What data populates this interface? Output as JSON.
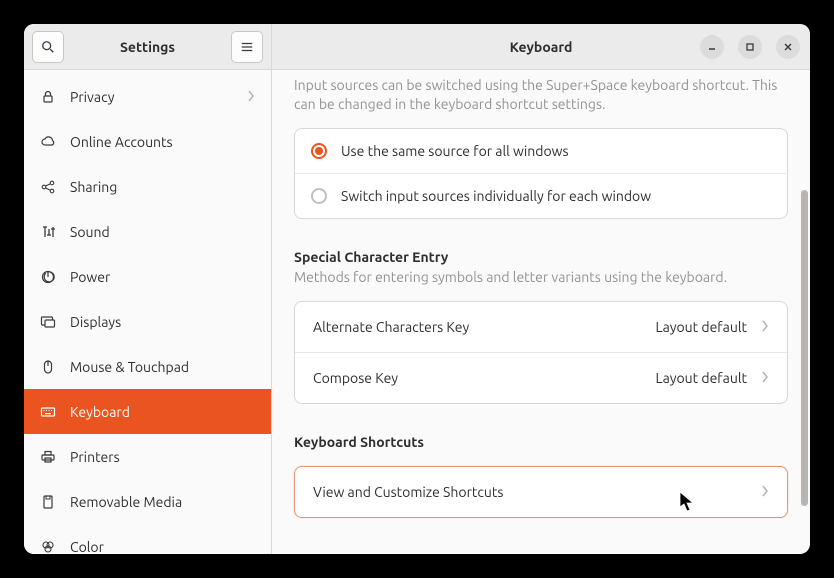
{
  "sidebar": {
    "title": "Settings",
    "items": [
      {
        "label": "Privacy",
        "icon": "lock",
        "chevron": true
      },
      {
        "label": "Online Accounts",
        "icon": "cloud"
      },
      {
        "label": "Sharing",
        "icon": "share"
      },
      {
        "label": "Sound",
        "icon": "sound"
      },
      {
        "label": "Power",
        "icon": "power"
      },
      {
        "label": "Displays",
        "icon": "displays"
      },
      {
        "label": "Mouse & Touchpad",
        "icon": "mouse"
      },
      {
        "label": "Keyboard",
        "icon": "keyboard",
        "active": true
      },
      {
        "label": "Printers",
        "icon": "printer"
      },
      {
        "label": "Removable Media",
        "icon": "media"
      },
      {
        "label": "Color",
        "icon": "color"
      }
    ]
  },
  "header": {
    "title": "Keyboard"
  },
  "main": {
    "intro": "Input sources can be switched using the Super+Space keyboard shortcut. This can be changed in the keyboard shortcut settings.",
    "radio": {
      "opt1": "Use the same source for all windows",
      "opt2": "Switch input sources individually for each window"
    },
    "special": {
      "title": "Special Character Entry",
      "desc": "Methods for entering symbols and letter variants using the keyboard.",
      "alt_label": "Alternate Characters Key",
      "alt_value": "Layout default",
      "compose_label": "Compose Key",
      "compose_value": "Layout default"
    },
    "shortcuts": {
      "title": "Keyboard Shortcuts",
      "view_label": "View and Customize Shortcuts"
    }
  }
}
